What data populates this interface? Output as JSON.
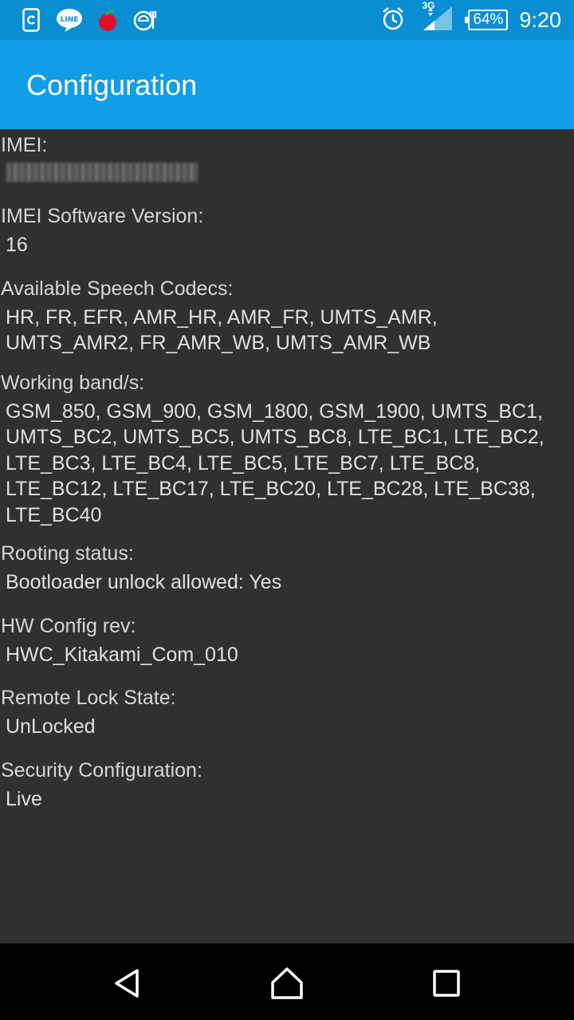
{
  "status_bar": {
    "time": "9:20",
    "battery": "64%",
    "network": "3G",
    "left_icons": [
      "sync-icon",
      "line-icon",
      "apple-icon",
      "food-icon"
    ],
    "right_icons": [
      "alarm-icon",
      "signal-icon"
    ]
  },
  "app_bar": {
    "title": "Configuration",
    "color": "#129ee6"
  },
  "fields": [
    {
      "label": "IMEI:",
      "value": ""
    },
    {
      "label": "IMEI Software Version:",
      "value": "16"
    },
    {
      "label": "Available Speech Codecs:",
      "value_lines": [
        "HR, FR, EFR, AMR_HR, AMR_FR, UMTS_AMR,",
        "UMTS_AMR2, FR_AMR_WB, UMTS_AMR_WB"
      ]
    },
    {
      "label": "Working band/s:",
      "value_lines": [
        "GSM_850, GSM_900, GSM_1800, GSM_1900, UMTS_BC1,",
        "UMTS_BC2, UMTS_BC5, UMTS_BC8, LTE_BC1, LTE_BC2,",
        "LTE_BC3, LTE_BC4, LTE_BC5, LTE_BC7, LTE_BC8,",
        "LTE_BC12, LTE_BC17, LTE_BC20, LTE_BC28, LTE_BC38,",
        "LTE_BC40"
      ]
    },
    {
      "label": "Rooting status:",
      "value": "Bootloader unlock allowed: Yes"
    },
    {
      "label": "HW Config rev:",
      "value": "HWC_Kitakami_Com_010"
    },
    {
      "label": "Remote Lock State:",
      "value": "UnLocked"
    },
    {
      "label": "Security Configuration:",
      "value": "Live"
    }
  ],
  "nav_bar": {
    "buttons": [
      "back-icon",
      "home-icon",
      "recents-icon"
    ]
  }
}
